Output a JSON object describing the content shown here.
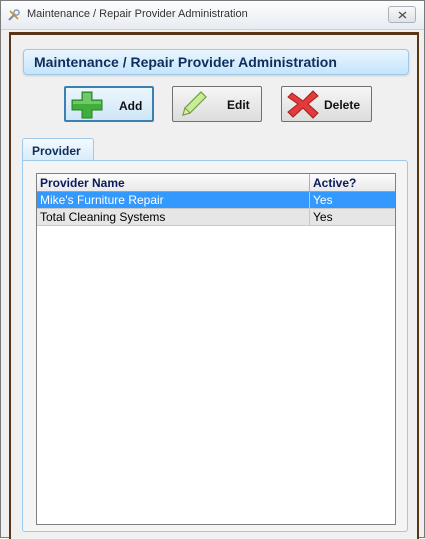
{
  "window": {
    "title": "Maintenance / Repair Provider Administration",
    "app_icon": "tools-icon",
    "close_icon": "close-icon"
  },
  "header": {
    "title": "Maintenance / Repair Provider Administration"
  },
  "toolbar": {
    "add_label": "Add",
    "edit_label": "Edit",
    "delete_label": "Delete",
    "add_icon": "plus-icon",
    "edit_icon": "pencil-icon",
    "delete_icon": "x-icon"
  },
  "tabs": [
    {
      "label": "Provider",
      "active": true
    }
  ],
  "grid": {
    "columns": [
      "Provider Name",
      "Active?"
    ],
    "rows": [
      {
        "name": "Mike's Furniture Repair",
        "active": "Yes",
        "selected": true
      },
      {
        "name": "Total Cleaning Systems",
        "active": "Yes",
        "selected": false
      }
    ]
  },
  "colors": {
    "accent": "#3399ff",
    "header_text": "#0e2e5c",
    "frame": "#5a3414"
  }
}
